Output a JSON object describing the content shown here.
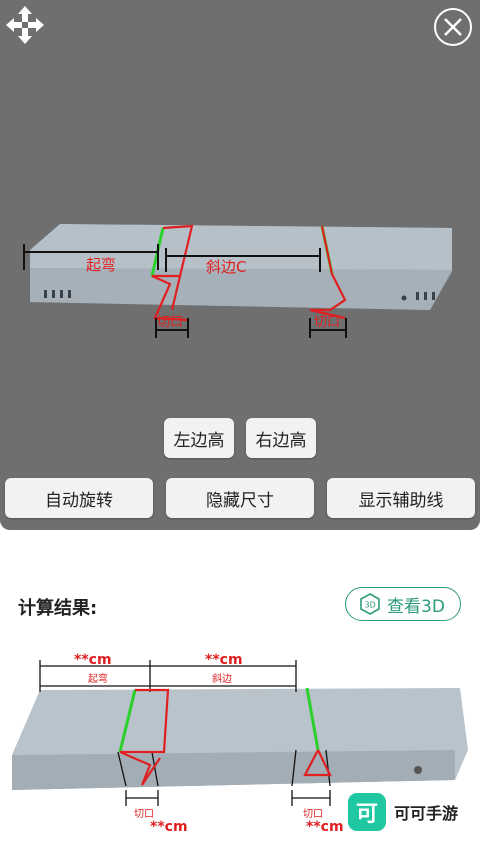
{
  "viewer": {
    "buttons_row1": {
      "left_height": "左边高",
      "right_height": "右边高"
    },
    "buttons_row2": {
      "auto_rotate": "自动旋转",
      "hide_dims": "隐藏尺寸",
      "show_guides": "显示辅助线"
    },
    "labels": {
      "bend": "起弯",
      "bevel": "斜边C",
      "cut_left": "切口",
      "cut_right": "切口"
    }
  },
  "result": {
    "title": "计算结果:",
    "view3d_label": "查看3D",
    "dims": {
      "top_left_value": "**cm",
      "top_left_label": "起弯",
      "top_right_value": "**cm",
      "top_right_label": "斜边",
      "cut_left_label": "切口",
      "cut_left_value": "**cm",
      "cut_right_label": "切口",
      "cut_right_value": "**cm"
    }
  },
  "watermark": {
    "logo_char": "可",
    "text": "可可手游"
  },
  "colors": {
    "accent": "#2c9a7c",
    "red": "#e02020",
    "green": "#2ad12a",
    "watermark": "#1fc8a0"
  }
}
